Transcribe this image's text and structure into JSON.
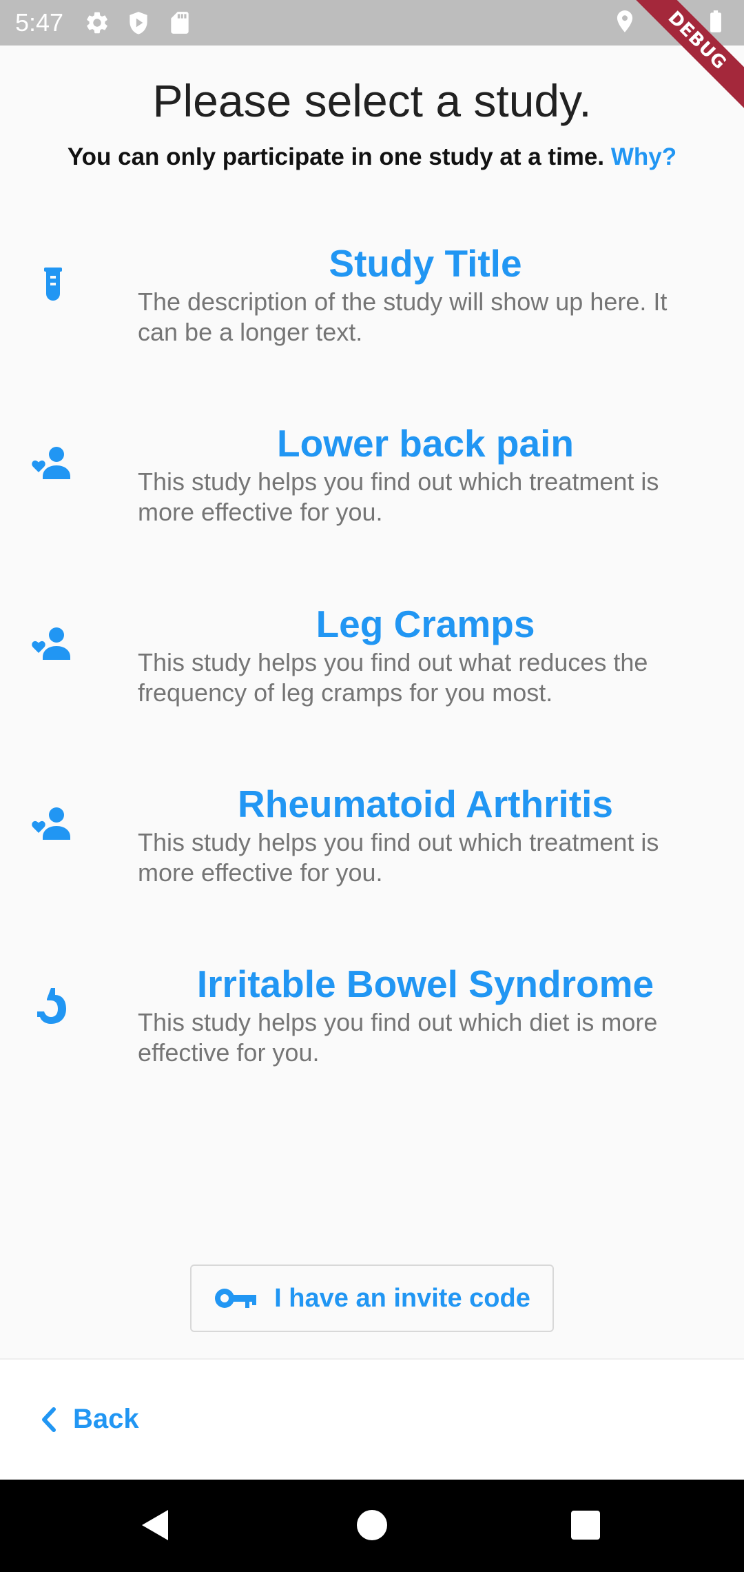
{
  "status_bar": {
    "time": "5:47",
    "icons_left": [
      "settings-icon",
      "play-protect-icon",
      "sd-card-icon"
    ],
    "icons_right": [
      "location-icon",
      "wifi-icon",
      "battery-icon"
    ]
  },
  "debug_banner": "DEBUG",
  "header": {
    "title": "Please select a study.",
    "subtitle": "You can only participate in one study at a time.",
    "why_link": "Why?"
  },
  "studies": [
    {
      "icon": "test-tube-icon",
      "title": "Study Title",
      "description": "The description of the study will show up here. It can be a longer text."
    },
    {
      "icon": "people-heart-icon",
      "title": "Lower back pain",
      "description": "This study helps you find out which treatment is more effective for you."
    },
    {
      "icon": "people-heart-icon",
      "title": "Leg Cramps",
      "description": "This study helps you find out what reduces the frequency of leg cramps for you most."
    },
    {
      "icon": "people-heart-icon",
      "title": "Rheumatoid Arthritis",
      "description": "This study helps you find out which treatment is more effective for you."
    },
    {
      "icon": "stomach-icon",
      "title": "Irritable Bowel Syndrome",
      "description": "This study helps you find out which diet is more effective for you."
    }
  ],
  "invite_button": {
    "icon": "key-icon",
    "label": "I have an invite code"
  },
  "bottom_bar": {
    "back_label": "Back",
    "back_icon": "chevron-left-icon"
  },
  "nav_bar": {
    "icons": [
      "nav-back-icon",
      "nav-home-icon",
      "nav-recents-icon"
    ]
  },
  "colors": {
    "accent": "#2196f3",
    "status_bar": "#bdbdbd",
    "background": "#fafafa",
    "description_text": "#757575",
    "debug_ribbon": "#a4283b"
  }
}
